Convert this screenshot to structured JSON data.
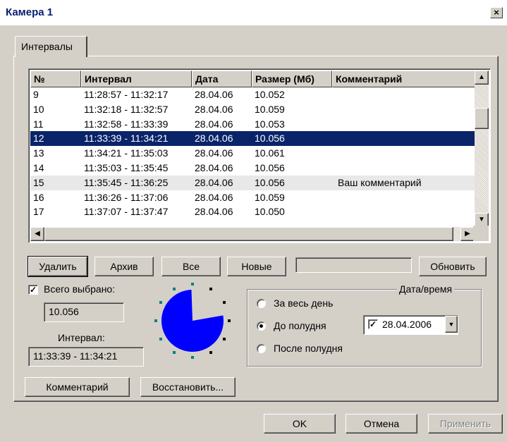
{
  "window": {
    "title": "Камера 1",
    "close_label": "×"
  },
  "tabs": [
    {
      "label": "Интервалы"
    }
  ],
  "table": {
    "columns": [
      "№",
      "Интервал",
      "Дата",
      "Размер (Мб)",
      "Комментарий"
    ],
    "rows": [
      [
        "9",
        "11:28:57 - 11:32:17",
        "28.04.06",
        "10.052",
        ""
      ],
      [
        "10",
        "11:32:18 - 11:32:57",
        "28.04.06",
        "10.059",
        ""
      ],
      [
        "11",
        "11:32:58 - 11:33:39",
        "28.04.06",
        "10.053",
        ""
      ],
      [
        "12",
        "11:33:39 - 11:34:21",
        "28.04.06",
        "10.056",
        ""
      ],
      [
        "13",
        "11:34:21 - 11:35:03",
        "28.04.06",
        "10.061",
        ""
      ],
      [
        "14",
        "11:35:03 - 11:35:45",
        "28.04.06",
        "10.056",
        ""
      ],
      [
        "15",
        "11:35:45 - 11:36:25",
        "28.04.06",
        "10.056",
        "Ваш комментарий"
      ],
      [
        "16",
        "11:36:26 - 11:37:06",
        "28.04.06",
        "10.059",
        ""
      ],
      [
        "17",
        "11:37:07 - 11:37:47",
        "28.04.06",
        "10.050",
        ""
      ]
    ],
    "selected_row": 3,
    "highlighted_row": 6
  },
  "actions": {
    "delete": "Удалить",
    "archive": "Архив",
    "all": "Все",
    "new": "Новые",
    "refresh": "Обновить"
  },
  "selection": {
    "total_checkbox_label": "Всего выбрано:",
    "total_checked": true,
    "total_value": "10.056",
    "interval_label": "Интервал:",
    "interval_value": "11:33:39 - 11:34:21"
  },
  "buttons": {
    "comment": "Комментарий",
    "restore": "Восстановить..."
  },
  "datetime_group": {
    "title": "Дата/время",
    "options": [
      "За весь день",
      "До полудня",
      "После полудня"
    ],
    "selected_option": 1,
    "date_checked": true,
    "date_value": "28.04.2006"
  },
  "dialog_buttons": {
    "ok": "OK",
    "cancel": "Отмена",
    "apply": "Применить"
  },
  "icons": {
    "clock": "clock-pie-icon",
    "scroll_up": "arrow-up-icon",
    "scroll_down": "arrow-down-icon",
    "scroll_left": "arrow-left-icon",
    "scroll_right": "arrow-right-icon",
    "dropdown": "chevron-down-icon"
  },
  "colors": {
    "selection": "#0a246a",
    "clock_fill": "#0000ff",
    "clock_dots": "#008080"
  }
}
